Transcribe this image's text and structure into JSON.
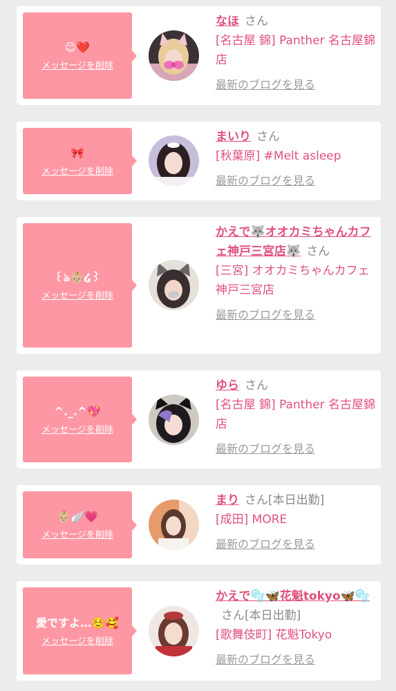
{
  "delete_label": "メッセージを削除",
  "blog_label": "最新のブログを見る",
  "san_label": "さん",
  "colors": {
    "bubble": "#fe97a4",
    "name": "#e0507c",
    "muted": "#8a8a8a",
    "background": "#ececec"
  },
  "entries": [
    {
      "message": "😉❤️",
      "name": "なほ",
      "status": "",
      "shop": "[名古屋 錦] Panther 名古屋錦店",
      "avatar_icon": "cat-ear-girl-avatar"
    },
    {
      "message": "🎀",
      "name": "まいり",
      "status": "",
      "shop": "[秋葉原] #Melt asleep",
      "avatar_icon": "girl-avatar"
    },
    {
      "message": "꒰ঌ👶🏼໒꒱",
      "name": "かえで🐺オオカミちゃんカフェ神戸三宮店🐺",
      "status": "",
      "shop": "[三宮] オオカミちゃんカフェ神戸三宮店",
      "avatar_icon": "wolf-ear-girl-avatar"
    },
    {
      "message": "^._.^💖",
      "name": "ゆら",
      "status": "",
      "shop": "[名古屋 錦] Panther 名古屋錦店",
      "avatar_icon": "cat-ear-girl-avatar"
    },
    {
      "message": "👶🏼🪽💗",
      "name": "まり",
      "status": "[本日出勤]",
      "shop": "[成田] MORE",
      "avatar_icon": "girl-avatar"
    },
    {
      "message": "愛ですよ…☺️🥰",
      "name": "かえで🫧🦋花魁tokyo🦋🫧",
      "status": "[本日出勤]",
      "shop": "[歌舞伎町] 花魁Tokyo",
      "avatar_icon": "girl-avatar"
    }
  ]
}
